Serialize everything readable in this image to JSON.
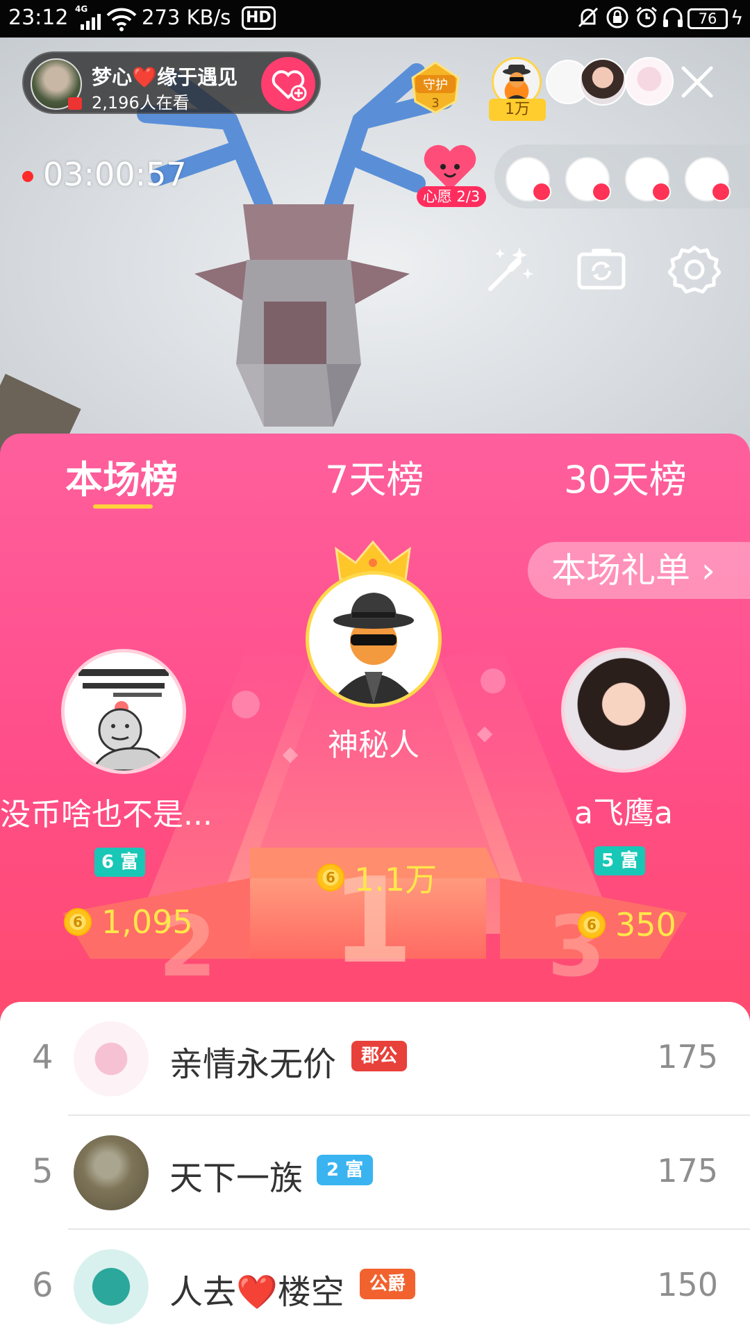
{
  "status_bar": {
    "time": "23:12",
    "network": "4G",
    "speed": "273 KB/s",
    "hd": "HD",
    "battery": "76"
  },
  "live": {
    "host_name": "梦心❤️缘于遇见",
    "viewers": "2,196人在看",
    "guard_label": "守护",
    "guard_count": "3",
    "top_viewer_badge": "1万",
    "duration": "03:00:57",
    "wish_label": "心愿 2/3"
  },
  "ranking": {
    "tabs": [
      "本场榜",
      "7天榜",
      "30天榜"
    ],
    "active_tab": 0,
    "gift_list_label": "本场礼单 ›",
    "podium": [
      {
        "place": "1",
        "name": "神秘人",
        "score": "1.1万",
        "badge": ""
      },
      {
        "place": "2",
        "name": "没币啥也不是...",
        "score": "1,095",
        "badge": "6 富"
      },
      {
        "place": "3",
        "name": "a飞鹰a",
        "score": "350",
        "badge": "5 富"
      }
    ],
    "coin_glyph": "6",
    "list": [
      {
        "rank": "4",
        "name": "亲情永无价",
        "badge": "郡公",
        "badge_color": "#e8403a",
        "score": "175"
      },
      {
        "rank": "5",
        "name": "天下一族",
        "badge": "2 富",
        "badge_color": "#3ab4f0",
        "score": "175"
      },
      {
        "rank": "6",
        "name": "人去❤️楼空",
        "badge": "公爵",
        "badge_color": "#f2622e",
        "score": "150"
      }
    ]
  },
  "colors": {
    "accent": "#ff4e8a",
    "gold": "#ffe74a",
    "rich_badge": "#19c7b7"
  }
}
